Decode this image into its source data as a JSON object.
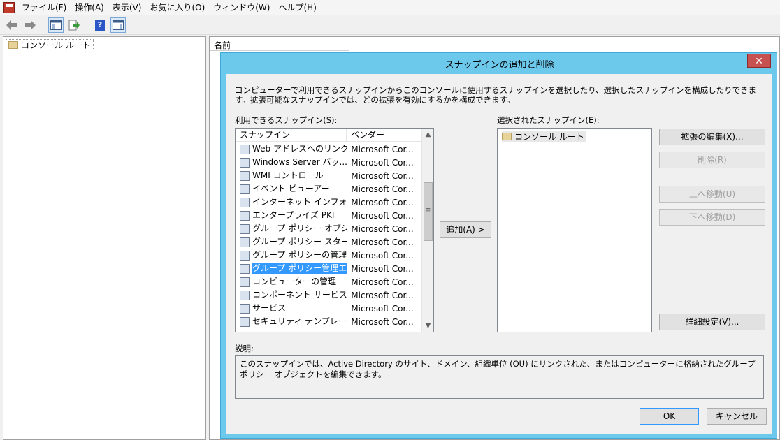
{
  "menubar": {
    "items": [
      "ファイル(F)",
      "操作(A)",
      "表示(V)",
      "お気に入り(O)",
      "ウィンドウ(W)",
      "ヘルプ(H)"
    ]
  },
  "toolbar": {
    "icons": [
      "back-arrow-icon",
      "forward-arrow-icon",
      "console-tree-icon",
      "export-icon",
      "help-icon",
      "action-pane-icon"
    ],
    "help_glyph": "?"
  },
  "left_pane": {
    "tree_root": "コンソール ルート"
  },
  "right_pane": {
    "column_header": "名前"
  },
  "dialog": {
    "title": "スナップインの追加と削除",
    "close_glyph": "✕",
    "description": "コンピューターで利用できるスナップインからこのコンソールに使用するスナップインを選択したり、選択したスナップインを構成したりできます。拡張可能なスナップインでは、どの拡張を有効にするかを構成できます。",
    "available_label": "利用できるスナップイン(S):",
    "available_columns": [
      "スナップイン",
      "ベンダー"
    ],
    "available_items": [
      {
        "name": "Web アドレスへのリンク",
        "vendor": "Microsoft Cor..."
      },
      {
        "name": "Windows Server バッ...",
        "vendor": "Microsoft Cor..."
      },
      {
        "name": "WMI コントロール",
        "vendor": "Microsoft Cor..."
      },
      {
        "name": "イベント ビューアー",
        "vendor": "Microsoft Cor..."
      },
      {
        "name": "インターネット インフォメー...",
        "vendor": "Microsoft Cor..."
      },
      {
        "name": "エンタープライズ PKI",
        "vendor": "Microsoft Cor..."
      },
      {
        "name": "グループ ポリシー オブジェ...",
        "vendor": "Microsoft Cor..."
      },
      {
        "name": "グループ ポリシー スタータ...",
        "vendor": "Microsoft Cor..."
      },
      {
        "name": "グループ ポリシーの管理",
        "vendor": "Microsoft Cor..."
      },
      {
        "name": "グループ ポリシー管理エデ...",
        "vendor": "Microsoft Cor..."
      },
      {
        "name": "コンピューターの管理",
        "vendor": "Microsoft Cor..."
      },
      {
        "name": "コンポーネント サービス",
        "vendor": "Microsoft Cor..."
      },
      {
        "name": "サービス",
        "vendor": "Microsoft Cor..."
      },
      {
        "name": "セキュリティ テンプレート",
        "vendor": "Microsoft Cor..."
      }
    ],
    "selected_index": 9,
    "add_button": "追加(A) >",
    "selected_label": "選択されたスナップイン(E):",
    "selected_items": [
      "コンソール ルート"
    ],
    "buttons": {
      "edit_extensions": "拡張の編集(X)...",
      "remove": "削除(R)",
      "move_up": "上へ移動(U)",
      "move_down": "下へ移動(D)",
      "advanced": "詳細設定(V)..."
    },
    "explanation_label": "説明:",
    "explanation": "このスナップインでは、Active Directory のサイト、ドメイン、組織単位 (OU) にリンクされた、またはコンピューターに格納されたグループ ポリシー オブジェクトを編集できます。",
    "ok": "OK",
    "cancel": "キャンセル"
  },
  "colors": {
    "dialog_frame": "#6cc9ec",
    "selection": "#3399ff",
    "close_button": "#c75050"
  }
}
